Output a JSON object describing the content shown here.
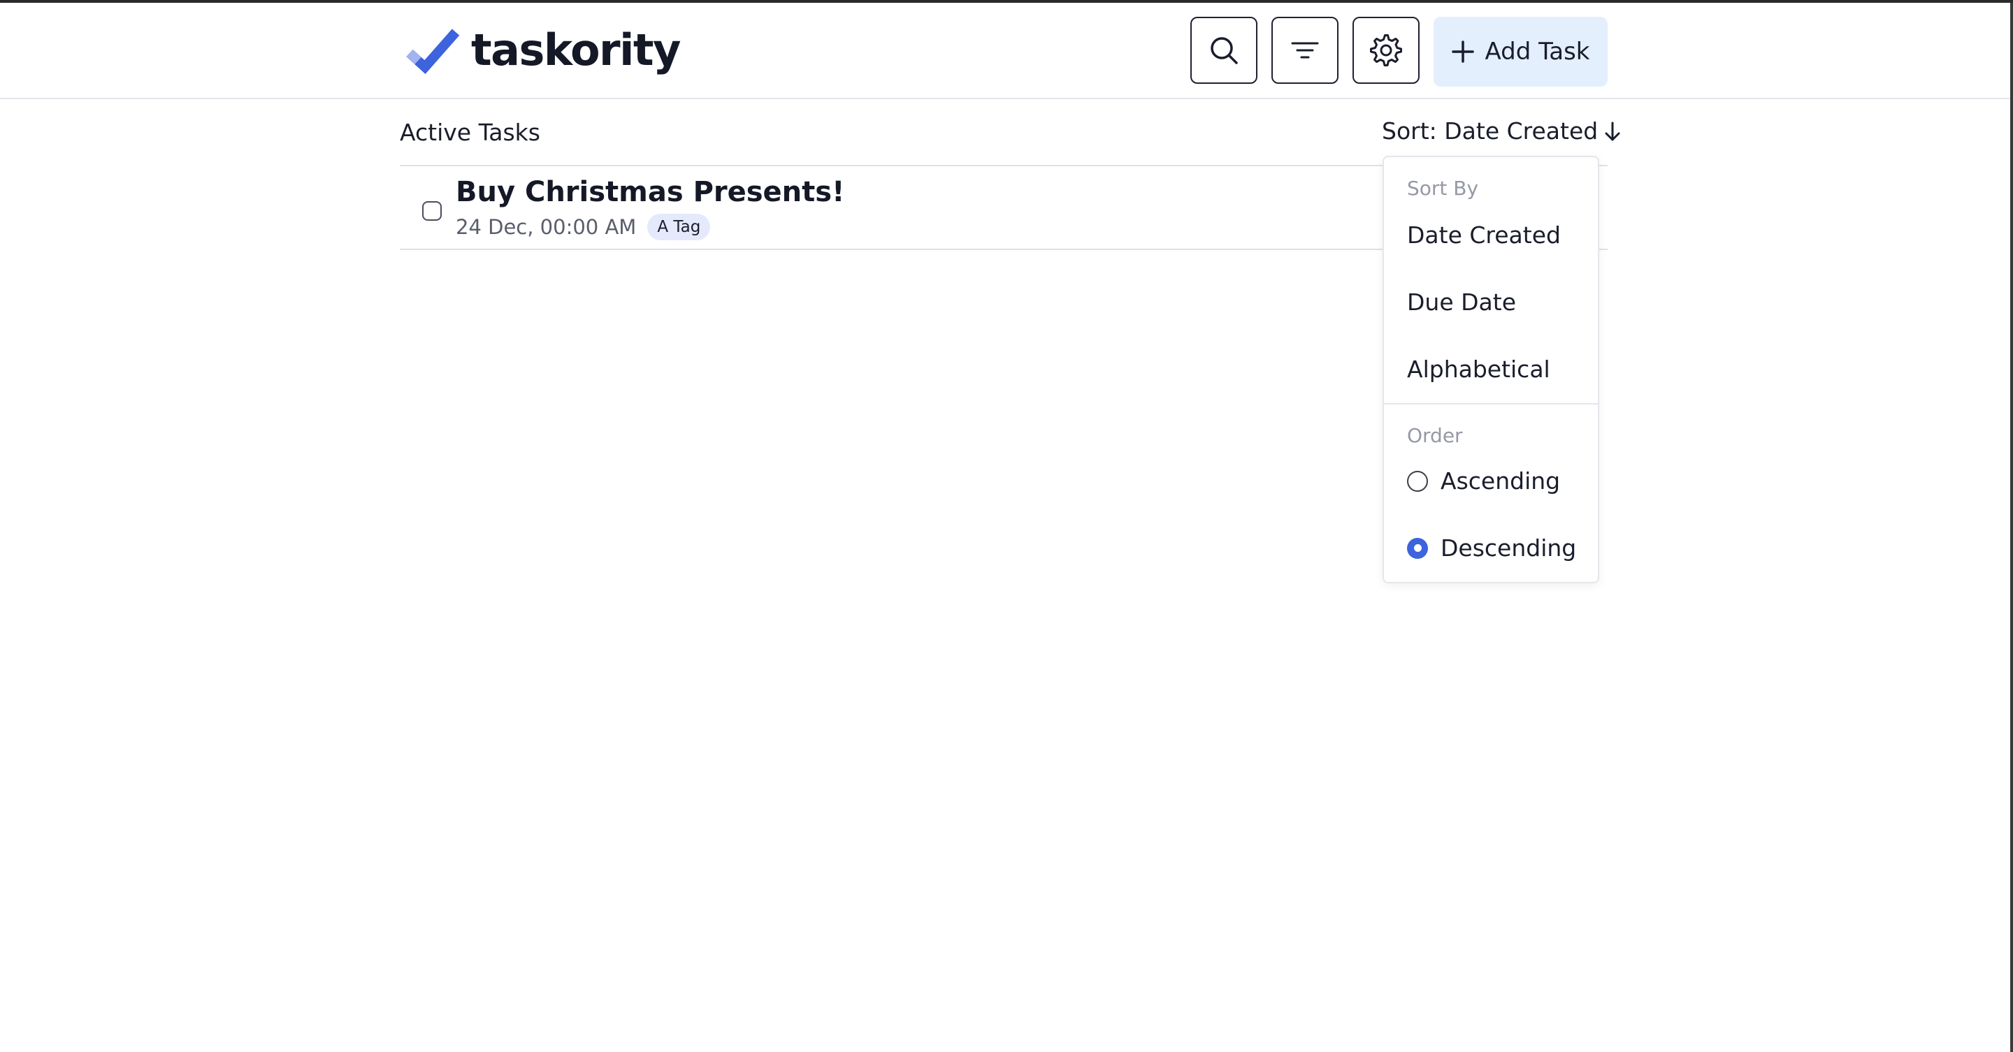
{
  "app": {
    "name": "taskority",
    "brand_color": "#3d63dd",
    "accent_bg": "#e3effc"
  },
  "header": {
    "search_icon": "search-icon",
    "filter_icon": "filter-icon",
    "settings_icon": "gear-icon",
    "add_task_label": "Add Task"
  },
  "list": {
    "title": "Active Tasks",
    "sort_label": "Sort: Date Created",
    "tasks": [
      {
        "title": "Buy Christmas Presents!",
        "date": "24 Dec, 00:00 AM",
        "tag": "A Tag",
        "completed": false
      }
    ]
  },
  "sort_menu": {
    "sort_by_heading": "Sort By",
    "options": [
      "Date Created",
      "Due Date",
      "Alphabetical"
    ],
    "order_heading": "Order",
    "order_options": [
      {
        "label": "Ascending",
        "selected": false
      },
      {
        "label": "Descending",
        "selected": true
      }
    ]
  }
}
